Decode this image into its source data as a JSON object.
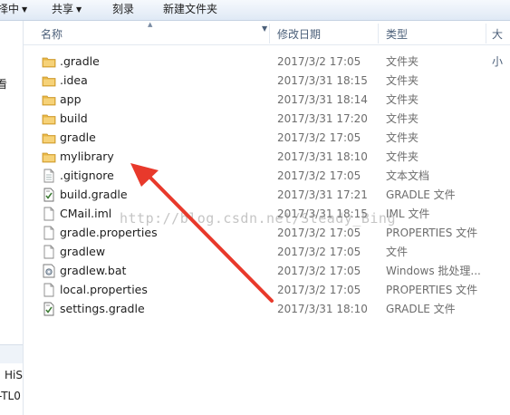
{
  "toolbar": {
    "partial_left": "择中",
    "share": "共享",
    "burn": "刻录",
    "new_folder": "新建文件夹"
  },
  "nav": {
    "frag1": "看",
    "frag2": "HiS",
    "frag3": "-TL0"
  },
  "columns": {
    "name": "名称",
    "date": "修改日期",
    "type": "类型",
    "size": "大小"
  },
  "files": [
    {
      "name": ".gradle",
      "date": "2017/3/2 17:05",
      "type": "文件夹",
      "icon": "folder-icon"
    },
    {
      "name": ".idea",
      "date": "2017/3/31 18:15",
      "type": "文件夹",
      "icon": "folder-icon"
    },
    {
      "name": "app",
      "date": "2017/3/31 18:14",
      "type": "文件夹",
      "icon": "folder-icon"
    },
    {
      "name": "build",
      "date": "2017/3/31 17:20",
      "type": "文件夹",
      "icon": "folder-icon"
    },
    {
      "name": "gradle",
      "date": "2017/3/2 17:05",
      "type": "文件夹",
      "icon": "folder-icon"
    },
    {
      "name": "mylibrary",
      "date": "2017/3/31 18:10",
      "type": "文件夹",
      "icon": "folder-icon"
    },
    {
      "name": ".gitignore",
      "date": "2017/3/2 17:05",
      "type": "文本文档",
      "icon": "text-file-icon"
    },
    {
      "name": "build.gradle",
      "date": "2017/3/31 17:21",
      "type": "GRADLE 文件",
      "icon": "gradle-file-icon"
    },
    {
      "name": "CMail.iml",
      "date": "2017/3/31 18:15",
      "type": "IML 文件",
      "icon": "file-icon"
    },
    {
      "name": "gradle.properties",
      "date": "2017/3/2 17:05",
      "type": "PROPERTIES 文件",
      "icon": "file-icon"
    },
    {
      "name": "gradlew",
      "date": "2017/3/2 17:05",
      "type": "文件",
      "icon": "file-icon"
    },
    {
      "name": "gradlew.bat",
      "date": "2017/3/2 17:05",
      "type": "Windows 批处理...",
      "icon": "batch-file-icon"
    },
    {
      "name": "local.properties",
      "date": "2017/3/2 17:05",
      "type": "PROPERTIES 文件",
      "icon": "file-icon"
    },
    {
      "name": "settings.gradle",
      "date": "2017/3/31 18:10",
      "type": "GRADLE 文件",
      "icon": "gradle-file-icon"
    }
  ],
  "watermark": "http://blog.csdn.net/Steady_Bing",
  "colors": {
    "folder": "#e8b745",
    "arrow": "#e8392b"
  }
}
